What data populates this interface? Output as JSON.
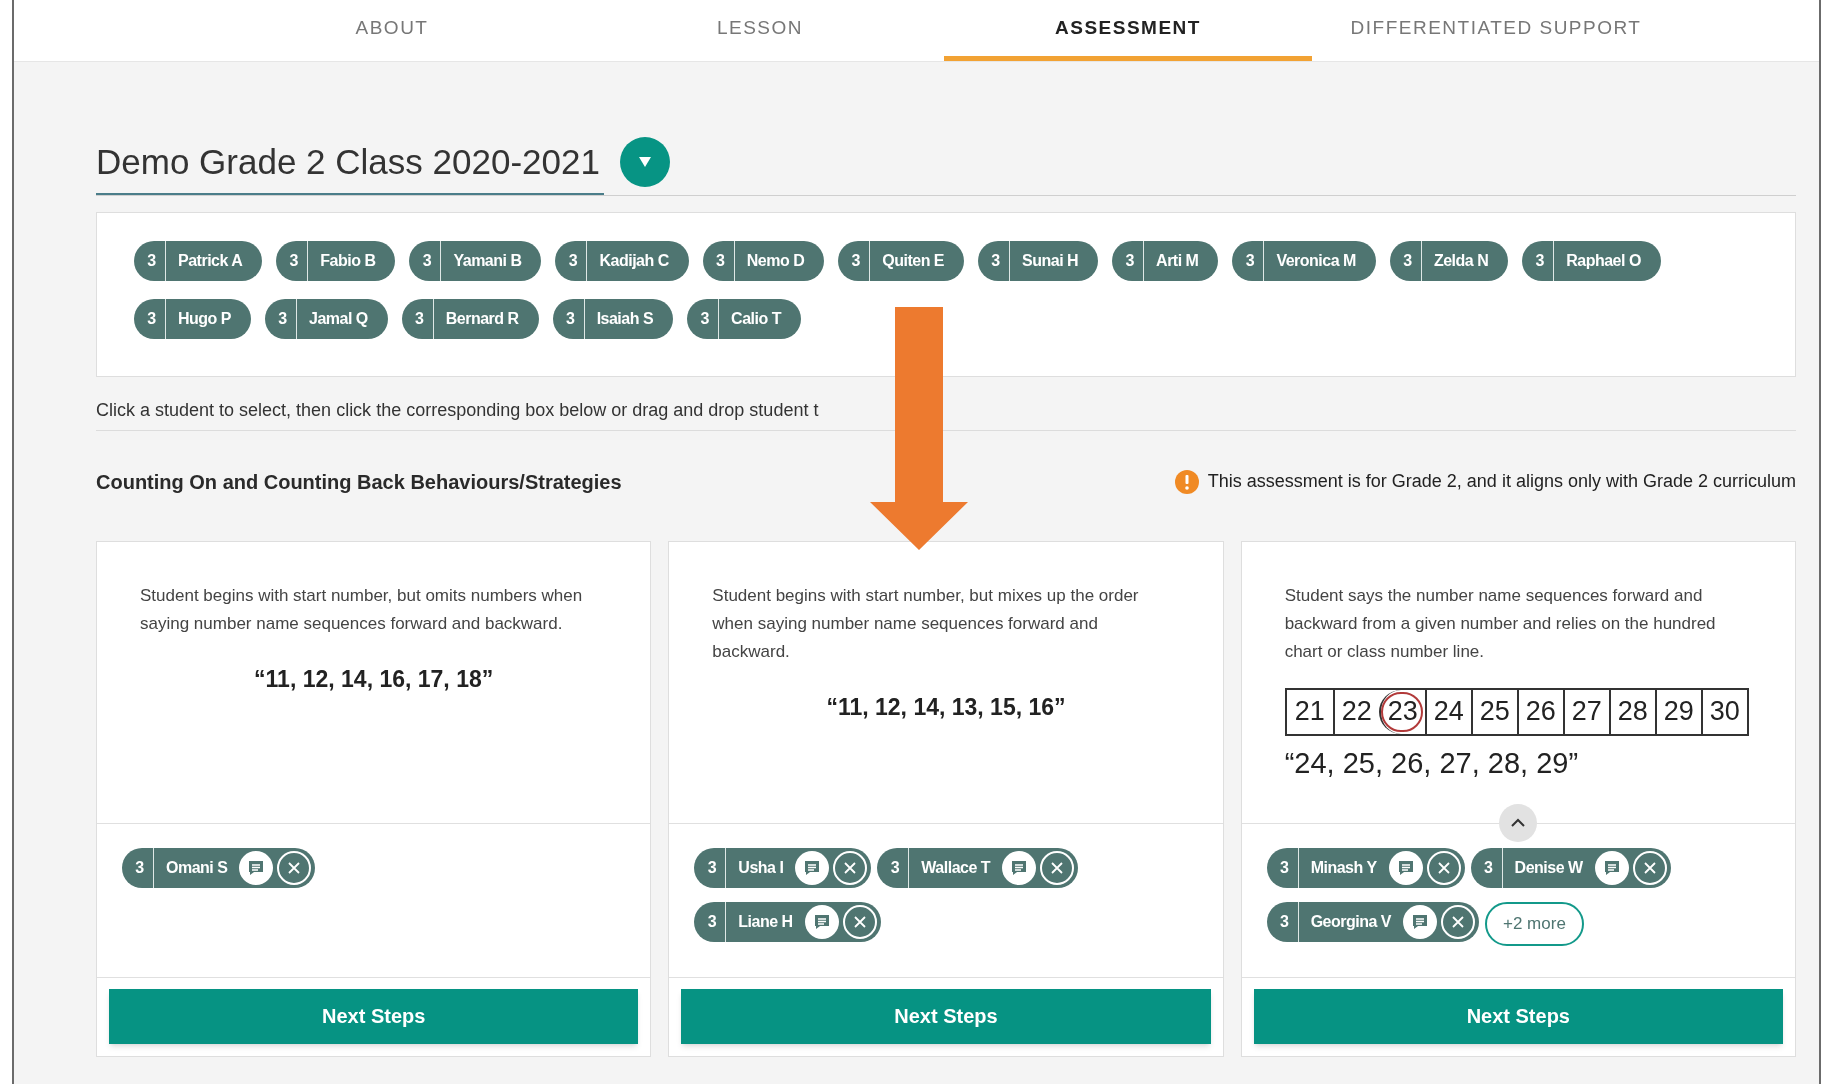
{
  "tabs": [
    {
      "label": "ABOUT",
      "selected": false
    },
    {
      "label": "LESSON",
      "selected": false
    },
    {
      "label": "ASSESSMENT",
      "selected": true
    },
    {
      "label": "DIFFERENTIATED SUPPORT",
      "selected": false
    }
  ],
  "class_selector": {
    "title": "Demo Grade 2 Class 2020-2021"
  },
  "roster": [
    {
      "level": "3",
      "name": "Patrick A"
    },
    {
      "level": "3",
      "name": "Fabio B"
    },
    {
      "level": "3",
      "name": "Yamani B"
    },
    {
      "level": "3",
      "name": "Kadijah C"
    },
    {
      "level": "3",
      "name": "Nemo D"
    },
    {
      "level": "3",
      "name": "Quiten E"
    },
    {
      "level": "3",
      "name": "Sunai H"
    },
    {
      "level": "3",
      "name": "Arti M"
    },
    {
      "level": "3",
      "name": "Veronica M"
    },
    {
      "level": "3",
      "name": "Zelda N"
    },
    {
      "level": "3",
      "name": "Raphael O"
    },
    {
      "level": "3",
      "name": "Hugo P"
    },
    {
      "level": "3",
      "name": "Jamal Q"
    },
    {
      "level": "3",
      "name": "Bernard R"
    },
    {
      "level": "3",
      "name": "Isaiah S"
    },
    {
      "level": "3",
      "name": "Calio T"
    }
  ],
  "instruction": "Click a student to select, then click the corresponding box below or drag and drop student t",
  "section": {
    "title": "Counting On and Counting Back Behaviours/Strategies",
    "notice": "This assessment is for Grade 2, and it aligns only with Grade 2 curriculum"
  },
  "cards": [
    {
      "kind": "quote",
      "description": "Student begins with start number, but omits numbers when saying number name sequences forward and backward.",
      "example": "“11, 12, 14, 16, 17, 18”",
      "collapse_toggle": false,
      "students": [
        {
          "level": "3",
          "name": "Omani S"
        }
      ],
      "button": "Next Steps"
    },
    {
      "kind": "quote",
      "description": "Student begins with start number, but mixes up the order when saying number name sequences forward and backward.",
      "example": "“11, 12, 14, 13, 15, 16”",
      "collapse_toggle": false,
      "students": [
        {
          "level": "3",
          "name": "Usha I"
        },
        {
          "level": "3",
          "name": "Wallace T"
        },
        {
          "level": "3",
          "name": "Liane H"
        }
      ],
      "button": "Next Steps"
    },
    {
      "kind": "number_chart",
      "description": "Student says the number name sequences forward and backward from a given number and relies on the hundred chart or class number line.",
      "numbers": [
        {
          "n": "21",
          "circled": false
        },
        {
          "n": "22",
          "circled": false
        },
        {
          "n": "23",
          "circled": true
        },
        {
          "n": "24",
          "circled": false
        },
        {
          "n": "25",
          "circled": false
        },
        {
          "n": "26",
          "circled": false
        },
        {
          "n": "27",
          "circled": false
        },
        {
          "n": "28",
          "circled": false
        },
        {
          "n": "29",
          "circled": false
        },
        {
          "n": "30",
          "circled": false
        }
      ],
      "example": "“24, 25, 26, 27, 28, 29”",
      "collapse_toggle": true,
      "students": [
        {
          "level": "3",
          "name": "Minash Y"
        },
        {
          "level": "3",
          "name": "Denise W"
        },
        {
          "level": "3",
          "name": "Georgina V"
        }
      ],
      "more": "+2 more",
      "button": "Next Steps"
    }
  ]
}
